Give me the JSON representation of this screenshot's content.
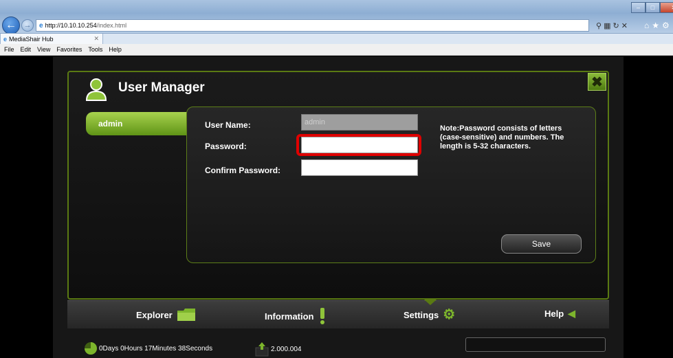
{
  "browser": {
    "url_host": "http://10.10.10.254",
    "url_path": "/index.html",
    "tab_title": "MediaShair Hub",
    "menu": [
      "File",
      "Edit",
      "View",
      "Favorites",
      "Tools",
      "Help"
    ]
  },
  "panel": {
    "title": "User Manager",
    "sidebar_user": "admin"
  },
  "form": {
    "username_label": "User Name:",
    "username_value": "admin",
    "password_label": "Password:",
    "password_value": "",
    "confirm_label": "Confirm Password:",
    "confirm_value": "",
    "note": "Note:Password consists of letters (case-sensitive) and numbers. The length is 5-32 characters.",
    "save_label": "Save"
  },
  "nav": {
    "explorer": "Explorer",
    "information": "Information",
    "settings": "Settings",
    "help": "Help"
  },
  "status": {
    "uptime": "0Days 0Hours 17Minutes 38Seconds",
    "version": "2.000.004"
  },
  "colors": {
    "accent_green": "#7db52c",
    "highlight_red": "#e00000"
  }
}
